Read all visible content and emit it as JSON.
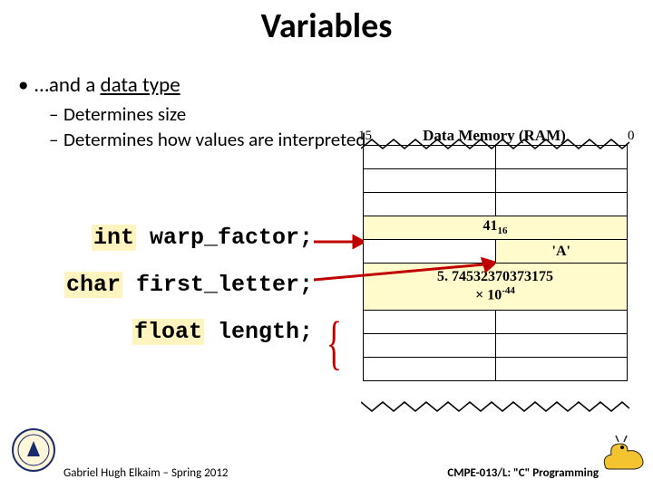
{
  "title": "Variables",
  "bullet": {
    "prefix": "…and a ",
    "underlined": "data type"
  },
  "subs": [
    "Determines size",
    "Determines how values are interpreted"
  ],
  "code": {
    "c1": {
      "kw": "int",
      "rest": " warp_factor;"
    },
    "c2": {
      "kw": "char",
      "rest": " first_letter;"
    },
    "c3": {
      "kw": "float",
      "rest": " length;"
    }
  },
  "memory": {
    "heading": "Data Memory (RAM)",
    "left": "15",
    "right": "0",
    "row_int": {
      "base": "41",
      "sub": "16"
    },
    "row_char": "'A'",
    "row_float": {
      "mantissa": "5. 74532370373175",
      "mult": "× 10",
      "exp": "-44"
    }
  },
  "footer": {
    "left": "Gabriel Hugh Elkaim – Spring 2012",
    "right": "CMPE-013/L: \"C\" Programming"
  },
  "icons": {
    "seal": "university-seal-icon",
    "slug": "banana-slug-icon"
  }
}
